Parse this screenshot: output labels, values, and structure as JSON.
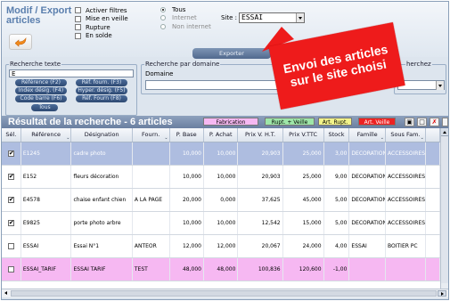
{
  "header": {
    "title_line1": "Modif / Export",
    "title_line2": "articles",
    "back_icon": "arrow-back-icon"
  },
  "filters": [
    {
      "label": "Activer filtres",
      "checked": false
    },
    {
      "label": "Mise en veille",
      "checked": false
    },
    {
      "label": "Rupture",
      "checked": false
    },
    {
      "label": "En solde",
      "checked": false
    }
  ],
  "radios": [
    {
      "label": "Tous",
      "selected": true
    },
    {
      "label": "Internet",
      "selected": false
    },
    {
      "label": "Non internet",
      "selected": false
    }
  ],
  "site": {
    "label": "Site :",
    "value": "ESSAI"
  },
  "export_button": "Exporter",
  "callout": {
    "line1": "Envoi des articles",
    "line2": "sur le site choisi",
    "color": "#ee1b1b"
  },
  "search": {
    "text_group_title": "Recherche texte",
    "text_value": "E",
    "pills": [
      "Référence (F2)",
      "Réf. fourn. (F3)",
      "Index désig. (F4)",
      "Hyper. désig. (F5)",
      "Code barre (F6)",
      "Réf. Fourn (F8)",
      "Tous"
    ],
    "domain_group_title": "Recherche par domaine",
    "domain_label": "Domaine",
    "right_group_title": "herchez"
  },
  "results": {
    "title": "Résultat de la recherche - 6 articles",
    "legend": [
      {
        "label": "Fabrication",
        "color": "#f6b8f2"
      },
      {
        "label": "Rupt. + Veille",
        "color": "#9ee6a8"
      },
      {
        "label": "Art. Rupt.",
        "color": "#f2f38a"
      },
      {
        "label": "Art. Veille",
        "color": "#ee2222"
      }
    ],
    "tools": [
      "copy-icon",
      "print-icon",
      "delete-icon",
      "export-icon"
    ]
  },
  "table": {
    "columns": [
      "Sél.",
      "Référence",
      "Désignation",
      "Fourn.",
      "P. Base",
      "P. Achat",
      "Prix V. H.T.",
      "Prix V.TTC",
      "Stock",
      "Famille",
      "Sous Fam."
    ],
    "rows": [
      {
        "checked": true,
        "style": "selected",
        "cells": [
          "E1245",
          "cadre photo",
          "",
          "10,000",
          "10,000",
          "20,903",
          "25,000",
          "3,00",
          "DECORATION",
          "ACCESSOIRES"
        ]
      },
      {
        "checked": true,
        "style": "",
        "cells": [
          "E152",
          "fleurs décoration",
          "",
          "10,000",
          "10,000",
          "20,903",
          "25,000",
          "9,00",
          "DECORATION",
          "ACCESSOIRES"
        ]
      },
      {
        "checked": true,
        "style": "",
        "cells": [
          "E4578",
          "chaise enfant chien",
          "A LA PAGE",
          "20,000",
          "0,000",
          "37,625",
          "45,000",
          "5,00",
          "DECORATION",
          "ACCESSOIRES"
        ]
      },
      {
        "checked": true,
        "style": "",
        "cells": [
          "E9825",
          "porte photo arbre",
          "",
          "10,000",
          "10,000",
          "12,542",
          "15,000",
          "5,00",
          "DECORATION",
          "ACCESSOIRES"
        ]
      },
      {
        "checked": false,
        "style": "",
        "cells": [
          "ESSAI",
          "Essai N°1",
          "ANTEOR",
          "12,000",
          "12,000",
          "20,067",
          "24,000",
          "4,00",
          "ESSAI",
          "BOITIER PC"
        ]
      },
      {
        "checked": false,
        "style": "pink",
        "cells": [
          "ESSAI_TARIF",
          "ESSAI TARIF",
          "TEST",
          "48,000",
          "48,000",
          "100,836",
          "120,600",
          "-1,00",
          "",
          ""
        ]
      }
    ]
  }
}
